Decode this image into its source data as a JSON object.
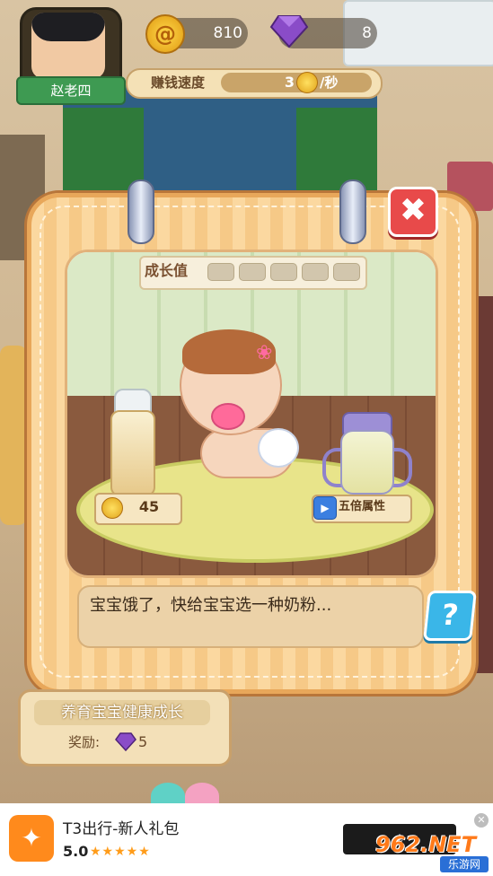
{
  "hud": {
    "player_name": "赵老四",
    "coins": "810",
    "gems": "8",
    "speed_label": "赚钱速度",
    "speed_value": "3",
    "speed_unit": "/秒"
  },
  "dialog": {
    "close_symbol": "✖",
    "growth_label": "成长值",
    "growth_slots": 5,
    "price_value": "45",
    "fivex_label": "五倍属性",
    "message": "宝宝饿了，快给宝宝选一种奶粉...",
    "help_symbol": "?"
  },
  "quest": {
    "title": "养育宝宝健康成长",
    "reward_label": "奖励:",
    "reward_value": "5"
  },
  "ad": {
    "title": "T3出行-新人礼包",
    "rating": "5.0",
    "stars": "★★★★★",
    "download_label": "⤓",
    "close_symbol": "✕",
    "logo_symbol": "✦"
  },
  "watermark": {
    "main": "962.NET",
    "sub": "乐游网"
  },
  "colors": {
    "accent_orange": "#e8a75a",
    "close_red": "#e84a4a",
    "help_blue": "#3ab6e8",
    "coin_gold": "#ffd84a",
    "gem_purple": "#7a3fb0"
  },
  "icons": [
    "coin-icon",
    "gem-icon",
    "close-icon",
    "help-icon",
    "video-icon",
    "app-logo-icon"
  ]
}
